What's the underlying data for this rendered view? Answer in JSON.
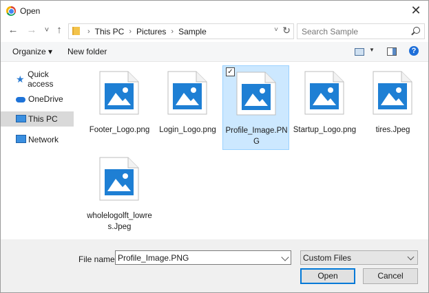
{
  "window": {
    "title": "Open",
    "close_glyph": "✕"
  },
  "nav": {
    "back_glyph": "←",
    "forward_glyph": "→",
    "recent_glyph": "˅",
    "up_glyph": "↑",
    "breadcrumbs": [
      "This PC",
      "Pictures",
      "Sample"
    ],
    "refresh_glyph": "↻",
    "search_placeholder": "Search Sample"
  },
  "toolbar": {
    "organize": "Organize ▾",
    "new_folder": "New folder",
    "help": "?"
  },
  "sidebar": {
    "items": [
      {
        "label": "Quick access",
        "icon": "star-icon"
      },
      {
        "label": "OneDrive",
        "icon": "cloud-icon"
      },
      {
        "label": "This PC",
        "icon": "pc-icon",
        "selected": true
      },
      {
        "label": "Network",
        "icon": "network-icon"
      }
    ]
  },
  "files": [
    {
      "name": "Footer_Logo.png"
    },
    {
      "name": "Login_Logo.png"
    },
    {
      "name": "Profile_Image.PNG",
      "selected": true
    },
    {
      "name": "Startup_Logo.png"
    },
    {
      "name": "tires.Jpeg"
    },
    {
      "name": "wholelogolft_lowres.Jpeg"
    }
  ],
  "bottom": {
    "file_name_label": "File name:",
    "file_name_value": "Profile_Image.PNG",
    "file_type": "Custom Files",
    "open": "Open",
    "cancel": "Cancel"
  },
  "colors": {
    "accent": "#0078d7",
    "selection_bg": "#cce8ff",
    "image_blue": "#1e7fd4"
  }
}
